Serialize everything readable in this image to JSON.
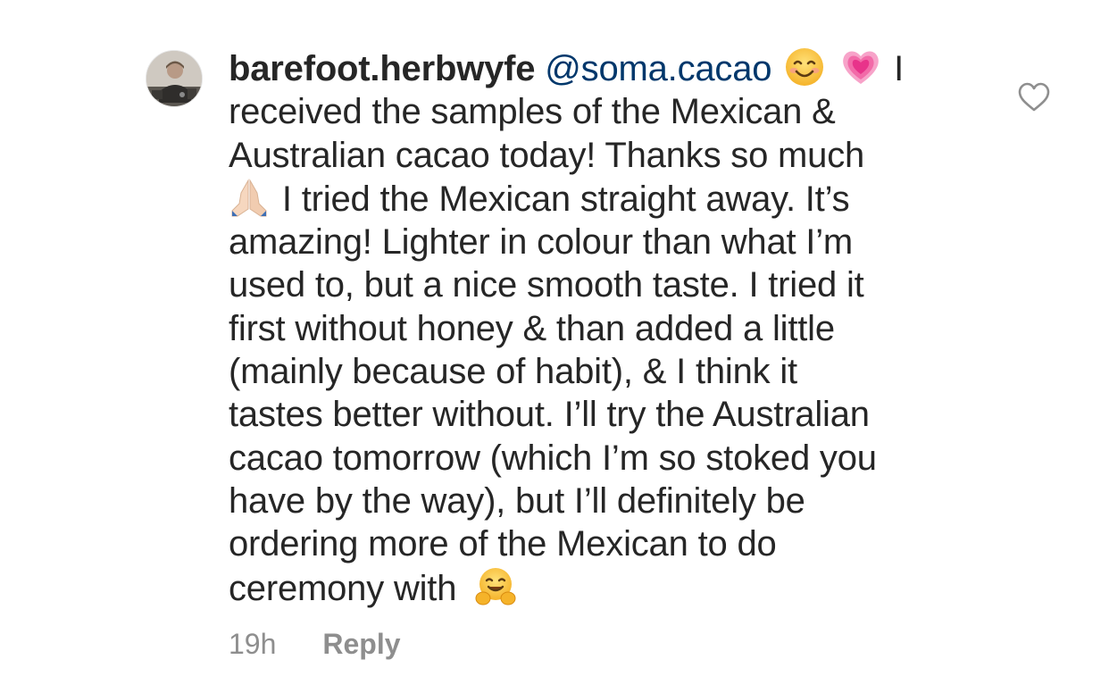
{
  "comment": {
    "username": "barefoot.herbwyfe",
    "mention": "@soma.cacao",
    "lines": [
      "I",
      "received the samples of the Mexican &",
      "Australian cacao today! Thanks so much",
      "I tried the Mexican straight away. It’s",
      "amazing! Lighter in colour than what I’m",
      "used to, but a nice smooth taste. I tried it",
      "first without honey & than added a little",
      "(mainly because of habit), & I think it",
      "tastes better without. I’ll try the Australian",
      "cacao tomorrow (which I’m so stoked you",
      "have by the way), but I’ll definitely be",
      "ordering more of the Mexican to do",
      "ceremony with"
    ],
    "emojis": {
      "smile": "smiling-face-emoji",
      "heart": "growing-heart-emoji",
      "pray": "folded-hands-emoji",
      "hug": "hugging-face-emoji"
    },
    "timestamp": "19h",
    "reply_label": "Reply"
  },
  "colors": {
    "text": "#262626",
    "mention": "#00376b",
    "meta": "#8e8e8e",
    "background": "#ffffff"
  },
  "icons": {
    "like": "heart-outline-icon"
  }
}
